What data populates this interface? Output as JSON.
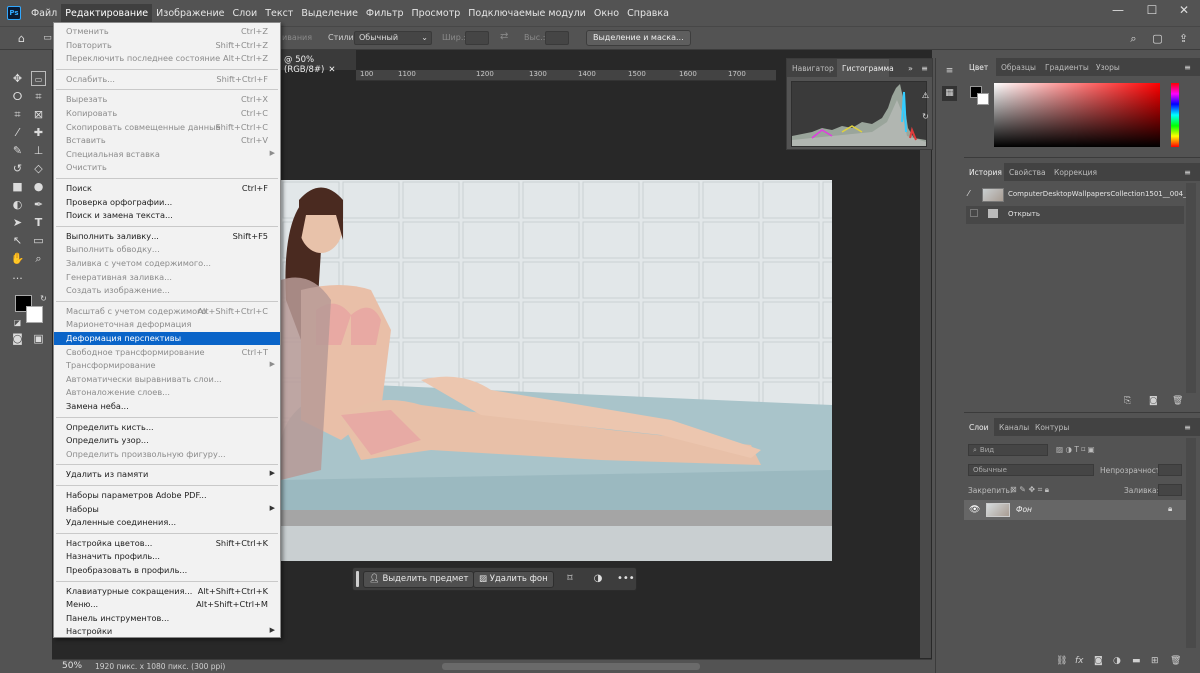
{
  "menubar": {
    "items": [
      "Файл",
      "Редактирование",
      "Изображение",
      "Слои",
      "Текст",
      "Выделение",
      "Фильтр",
      "Просмотр",
      "Подключаемые модули",
      "Окно",
      "Справка"
    ],
    "active_index": 1,
    "ps_logo": "Ps"
  },
  "optionsbar": {
    "styles_label": "Стили:",
    "styles_value": "Обычный",
    "width_label": "Шир.:",
    "height_label": "Выс.:",
    "mask_button": "Выделение и маска...",
    "partial_label": "ивания"
  },
  "document": {
    "tab_title": "@ 50% (RGB/8#)",
    "ruler": [
      "100",
      "1100",
      "1200",
      "1300",
      "1400",
      "1500",
      "1600",
      "1700"
    ]
  },
  "taskbar": {
    "select_subject": "Выделить предмет",
    "remove_bg": "Удалить фон"
  },
  "status": {
    "zoom": "50%",
    "info": "1920 пикс. x 1080 пикс. (300 ppi)"
  },
  "edit_menu": {
    "items": [
      {
        "label": "Отменить",
        "shortcut": "Ctrl+Z",
        "disabled": true
      },
      {
        "label": "Повторить",
        "shortcut": "Shift+Ctrl+Z",
        "disabled": true
      },
      {
        "label": "Переключить последнее состояние",
        "shortcut": "Alt+Ctrl+Z",
        "disabled": true
      },
      {
        "label": "Ослабить...",
        "shortcut": "Shift+Ctrl+F",
        "disabled": true
      },
      {
        "label": "Вырезать",
        "shortcut": "Ctrl+X",
        "disabled": true
      },
      {
        "label": "Копировать",
        "shortcut": "Ctrl+C",
        "disabled": true
      },
      {
        "label": "Скопировать совмещенные данные",
        "shortcut": "Shift+Ctrl+C",
        "disabled": true
      },
      {
        "label": "Вставить",
        "shortcut": "Ctrl+V",
        "disabled": true
      },
      {
        "label": "Специальная вставка",
        "shortcut": "",
        "disabled": true,
        "submenu": true
      },
      {
        "label": "Очистить",
        "shortcut": "",
        "disabled": true
      },
      {
        "label": "Поиск",
        "shortcut": "Ctrl+F",
        "disabled": false
      },
      {
        "label": "Проверка орфографии...",
        "shortcut": "",
        "disabled": false
      },
      {
        "label": "Поиск и замена текста...",
        "shortcut": "",
        "disabled": false
      },
      {
        "label": "Выполнить заливку...",
        "shortcut": "Shift+F5",
        "disabled": false
      },
      {
        "label": "Выполнить обводку...",
        "shortcut": "",
        "disabled": true
      },
      {
        "label": "Заливка с учетом содержимого...",
        "shortcut": "",
        "disabled": true
      },
      {
        "label": "Генеративная заливка...",
        "shortcut": "",
        "disabled": true
      },
      {
        "label": "Создать изображение...",
        "shortcut": "",
        "disabled": true
      },
      {
        "label": "Масштаб с учетом содержимого",
        "shortcut": "Alt+Shift+Ctrl+C",
        "disabled": true
      },
      {
        "label": "Марионеточная деформация",
        "shortcut": "",
        "disabled": true
      },
      {
        "label": "Деформация перспективы",
        "shortcut": "",
        "disabled": false,
        "selected": true
      },
      {
        "label": "Свободное трансформирование",
        "shortcut": "Ctrl+T",
        "disabled": true
      },
      {
        "label": "Трансформирование",
        "shortcut": "",
        "disabled": true,
        "submenu": true
      },
      {
        "label": "Автоматически выравнивать слои...",
        "shortcut": "",
        "disabled": true
      },
      {
        "label": "Автоналожение слоев...",
        "shortcut": "",
        "disabled": true
      },
      {
        "label": "Замена неба...",
        "shortcut": "",
        "disabled": false
      },
      {
        "label": "Определить кисть...",
        "shortcut": "",
        "disabled": false
      },
      {
        "label": "Определить узор...",
        "shortcut": "",
        "disabled": false
      },
      {
        "label": "Определить произвольную фигуру...",
        "shortcut": "",
        "disabled": true
      },
      {
        "label": "Удалить из памяти",
        "shortcut": "",
        "disabled": false,
        "submenu": true
      },
      {
        "label": "Наборы параметров Adobe PDF...",
        "shortcut": "",
        "disabled": false
      },
      {
        "label": "Наборы",
        "shortcut": "",
        "disabled": false,
        "submenu": true
      },
      {
        "label": "Удаленные соединения...",
        "shortcut": "",
        "disabled": false
      },
      {
        "label": "Настройка цветов...",
        "shortcut": "Shift+Ctrl+K",
        "disabled": false
      },
      {
        "label": "Назначить профиль...",
        "shortcut": "",
        "disabled": false
      },
      {
        "label": "Преобразовать в профиль...",
        "shortcut": "",
        "disabled": false
      },
      {
        "label": "Клавиатурные сокращения...",
        "shortcut": "Alt+Shift+Ctrl+K",
        "disabled": false
      },
      {
        "label": "Меню...",
        "shortcut": "Alt+Shift+Ctrl+M",
        "disabled": false
      },
      {
        "label": "Панель инструментов...",
        "shortcut": "",
        "disabled": false
      },
      {
        "label": "Настройки",
        "shortcut": "",
        "disabled": false,
        "submenu": true
      }
    ]
  },
  "navigator_panel": {
    "tabs": [
      "Навигатор",
      "Гистограмма"
    ],
    "active_index": 1
  },
  "color_panel": {
    "tabs": [
      "Цвет",
      "Образцы",
      "Градиенты",
      "Узоры"
    ],
    "active_index": 0
  },
  "history_panel": {
    "tabs": [
      "История",
      "Свойства",
      "Коррекция"
    ],
    "active_index": 0,
    "snapshot": "ComputerDesktopWallpapersCollection1501__004_r...",
    "states": [
      "Открыть"
    ]
  },
  "layers_panel": {
    "tabs": [
      "Слои",
      "Каналы",
      "Контуры"
    ],
    "active_index": 0,
    "search_placeholder": "Вид",
    "blend_mode": "Обычные",
    "opacity_label": "Непрозрачность:",
    "lock_label": "Закрепить:",
    "fill_label": "Заливка:",
    "layer_name": "Фон"
  },
  "colors": {
    "selection": "#0a64c8",
    "ps_blue": "#31a8ff"
  }
}
